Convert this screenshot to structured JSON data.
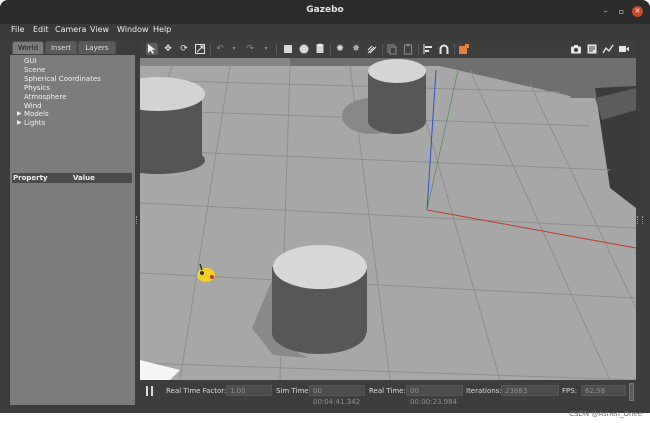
{
  "window": {
    "title": "Gazebo"
  },
  "window_buttons": {
    "minimize": "–",
    "maximize": "▫",
    "close": "✕"
  },
  "menu": [
    "File",
    "Edit",
    "Camera",
    "View",
    "Window",
    "Help"
  ],
  "left_panel": {
    "tabs": [
      {
        "label": "World",
        "active": true
      },
      {
        "label": "Insert"
      },
      {
        "label": "Layers"
      }
    ],
    "tree": [
      {
        "label": "GUI"
      },
      {
        "label": "Scene"
      },
      {
        "label": "Spherical Coordinates"
      },
      {
        "label": "Physics"
      },
      {
        "label": "Atmosphere"
      },
      {
        "label": "Wind"
      },
      {
        "label": "Models",
        "expandable": true
      },
      {
        "label": "Lights",
        "expandable": true
      }
    ],
    "property_header": {
      "property": "Property",
      "value": "Value"
    }
  },
  "toolbar": {
    "icons": [
      "select-arrow-icon",
      "translate-icon",
      "rotate-icon",
      "scale-icon",
      "undo-icon",
      "undo-menu-icon",
      "redo-icon",
      "redo-menu-icon",
      "box-shape-icon",
      "sphere-shape-icon",
      "cylinder-shape-icon",
      "point-light-icon",
      "spot-light-icon",
      "directional-light-icon",
      "copy-icon",
      "paste-icon",
      "align-icon",
      "snap-icon",
      "view-angle-icon",
      "screenshot-icon",
      "log-icon",
      "plot-icon",
      "record-video-icon"
    ]
  },
  "status": {
    "real_time_factor_label": "Real Time Factor:",
    "real_time_factor": "1.00",
    "sim_time_label": "Sim Time:",
    "sim_time": "00 00:04:41.342",
    "real_time_label": "Real Time:",
    "real_time": "00 00:00:23.984",
    "iterations_label": "Iterations:",
    "iterations": "23883",
    "fps_label": "FPS:",
    "fps": "62.58"
  },
  "watermark": "CSDN @Ashen_Onee",
  "colors": {
    "ground": "#a7a7a7",
    "grid": "#8f8f8f",
    "cylinder": "#595959",
    "robot": "#f2d21e",
    "x_axis": "#c0392b",
    "z_axis": "#2a4fd6"
  }
}
